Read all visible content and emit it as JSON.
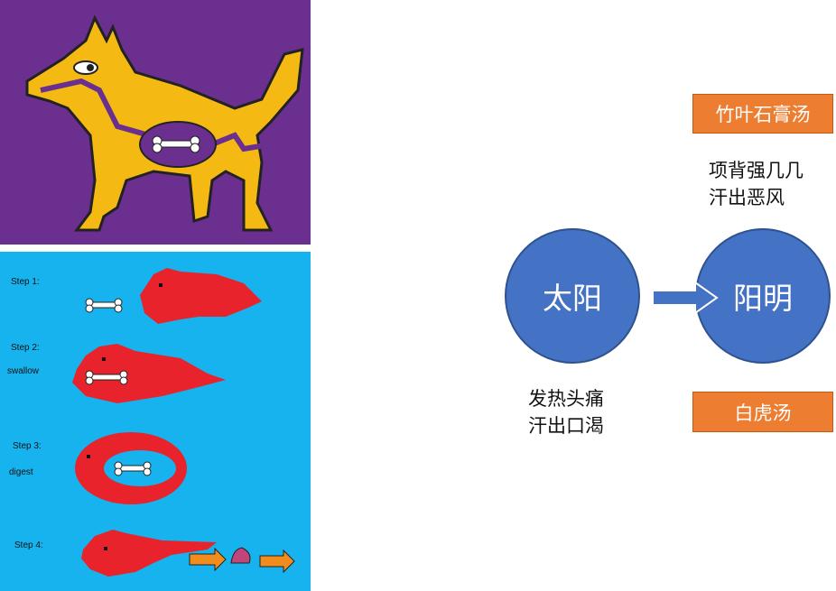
{
  "steps": {
    "s1": "Step 1:",
    "s2": "Step 2:",
    "s2b": "swallow",
    "s3": "Step 3:",
    "s3b": "digest",
    "s4": "Step 4:"
  },
  "diagram": {
    "left_node": "太阳",
    "right_node": "阳明",
    "top_box": "竹叶石膏汤",
    "bottom_box": "白虎汤",
    "top_symptoms": [
      "项背强几几",
      "汗出恶风"
    ],
    "bottom_symptoms": [
      "发热头痛",
      "汗出口渴"
    ]
  },
  "colors": {
    "node_fill": "#4472c4",
    "box_fill": "#ed7d31",
    "arrow_fill": "#4472c4"
  }
}
